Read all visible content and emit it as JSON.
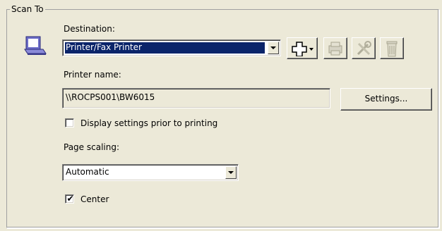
{
  "group": {
    "title": "Scan To"
  },
  "destination": {
    "label": "Destination:",
    "value": "Printer/Fax Printer",
    "icon": "scanner-printer-icon"
  },
  "toolbar": {
    "add_icon": "add-plus-icon",
    "edit_icon": "edit-printer-icon",
    "settings_icon": "tools-icon",
    "delete_icon": "trash-icon"
  },
  "printer": {
    "label": "Printer name:",
    "value": "\\\\ROCPS001\\BW6015",
    "settings_button": "Settings..."
  },
  "display_settings": {
    "label": "Display settings prior to printing",
    "checked": false
  },
  "page_scaling": {
    "label": "Page scaling:",
    "value": "Automatic"
  },
  "center": {
    "label": "Center",
    "checked": true,
    "check_glyph": "✔"
  }
}
